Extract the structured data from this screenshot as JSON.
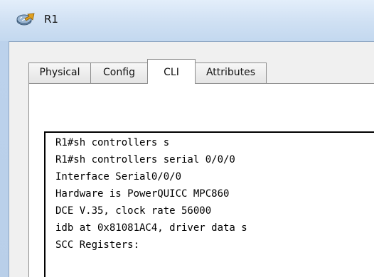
{
  "window": {
    "title": "R1",
    "icon": "router-icon"
  },
  "tabs": [
    {
      "label": "Physical",
      "active": false
    },
    {
      "label": "Config",
      "active": false
    },
    {
      "label": "CLI",
      "active": true
    },
    {
      "label": "Attributes",
      "active": false
    }
  ],
  "cli": {
    "lines": [
      "R1#sh controllers s",
      "R1#sh controllers serial 0/0/0",
      "Interface Serial0/0/0",
      "Hardware is PowerQUICC MPC860",
      "DCE V.35, clock rate 56000",
      "idb at 0x81081AC4, driver data s",
      "SCC Registers:"
    ]
  }
}
